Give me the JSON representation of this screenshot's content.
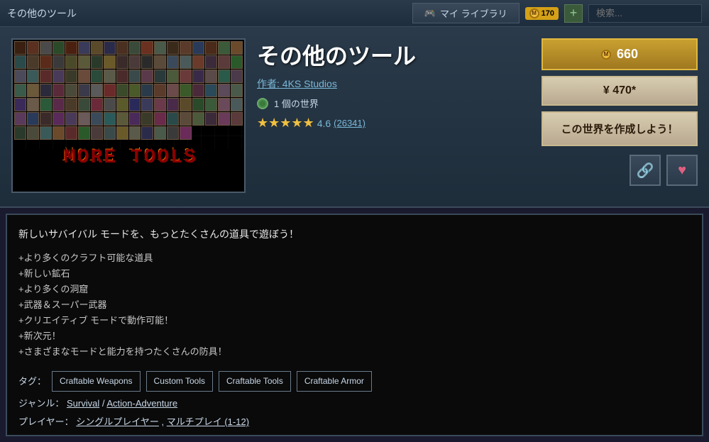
{
  "topbar": {
    "title": "その他のツール",
    "library_label": "マイ ライブラリ",
    "coin_amount": "170",
    "add_label": "+",
    "search_placeholder": "検索..."
  },
  "product": {
    "title": "その他のツール",
    "author": "作者: 4KS Studios",
    "worlds": "1 個の世界",
    "rating_stars": "★★★★★",
    "rating_value": "4.6",
    "rating_count": "(26341)",
    "coin_price": "660",
    "yen_price": "¥ 470*",
    "create_btn": "この世界を作成しよう！",
    "share_icon": "🔗",
    "wishlist_icon": "♥",
    "image_alt": "MORE TOOLS",
    "image_text": "MORE TOOLS"
  },
  "description": {
    "headline": "新しいサバイバル モードを、もっとたくさんの道具で遊ぼう！",
    "features": [
      "+より多くのクラフト可能な道具",
      "+新しい鉱石",
      "+より多くの洞窟",
      "+武器＆スーパー武器",
      "+クリエイティブ モードで動作可能！",
      "+新次元！",
      "+さまざまなモードと能力を持つたくさんの防具！"
    ]
  },
  "tags": {
    "label": "タグ：",
    "items": [
      "Craftable Weapons",
      "Custom Tools",
      "Craftable Tools",
      "Craftable Armor"
    ]
  },
  "genre": {
    "label": "ジャンル：",
    "items": [
      "Survival",
      "Action-Adventure"
    ]
  },
  "players": {
    "label": "プレイヤー：",
    "items": [
      "シングルプレイヤー",
      "マルチプレイ (1-12)"
    ]
  }
}
